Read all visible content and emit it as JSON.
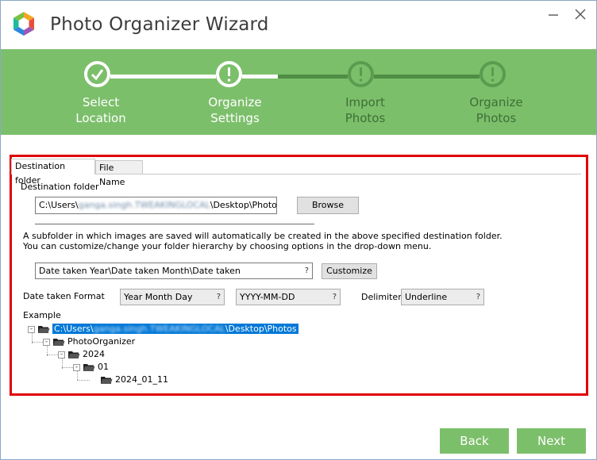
{
  "window": {
    "title": "Photo Organizer Wizard",
    "minimize_glyph": "?",
    "close_glyph": "?"
  },
  "steps": [
    {
      "line1": "Select",
      "line2": "Location",
      "state": "done"
    },
    {
      "line1": "Organize",
      "line2": "Settings",
      "state": "current"
    },
    {
      "line1": "Import",
      "line2": "Photos",
      "state": "todo"
    },
    {
      "line1": "Organize",
      "line2": "Photos",
      "state": "todo"
    }
  ],
  "tabs": {
    "active": "Destination folder",
    "inactive": "File Name"
  },
  "destination": {
    "label": "Destination folder",
    "path_prefix": "C:\\Users\\",
    "path_blurred": "ganga.singh.TWEAKINGLOCAL",
    "path_suffix": "\\Desktop\\Photos",
    "browse_label": "Browse"
  },
  "info": {
    "line1": "A subfolder in which images are saved will automatically be created in the above specified destination folder.",
    "line2": "You can customize/change your folder hierarchy by choosing options in the drop-down menu."
  },
  "hierarchy": {
    "selected": "Date taken Year\\Date taken Month\\Date taken",
    "customize_label": "Customize"
  },
  "format": {
    "label": "Date taken Format",
    "order_selected": "Year Month Day",
    "pattern_selected": "YYYY-MM-DD",
    "delimiter_label": "Delimiter",
    "delimiter_selected": "Underline"
  },
  "example": {
    "label": "Example",
    "root_prefix": "C:\\Users\\",
    "root_blurred": "ganga.singh.TWEAKINGLOCAL",
    "root_suffix": "\\Desktop\\Photos",
    "level1": "PhotoOrganizer",
    "level2": "2024",
    "level3": "01",
    "level4": "2024_01_11"
  },
  "nav": {
    "back": "Back",
    "next": "Next"
  },
  "colors": {
    "accent_green": "#7cbf6b",
    "highlight_red": "#e00000",
    "selection_blue": "#0078d7"
  }
}
